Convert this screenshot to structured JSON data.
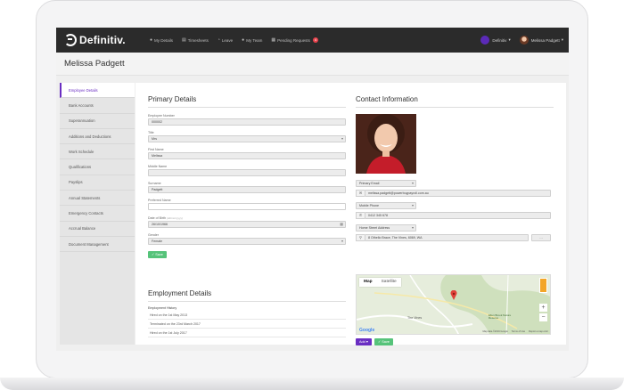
{
  "nav": {
    "brand": "Definitiv.",
    "items": [
      {
        "icon": "person-icon",
        "label": "My Details"
      },
      {
        "icon": "timesheet-icon",
        "label": "Timesheets"
      },
      {
        "icon": "leave-icon",
        "label": "Leave"
      },
      {
        "icon": "team-icon",
        "label": "My Team"
      },
      {
        "icon": "pending-icon",
        "label": "Pending Requests",
        "badge": "4"
      }
    ],
    "org": "Definitiv",
    "user": "Melissa Padgett"
  },
  "page": {
    "title": "Melissa Padgett"
  },
  "sidebar": {
    "items": [
      {
        "label": "Employee Details",
        "active": true
      },
      {
        "label": "Bank Accounts"
      },
      {
        "label": "Superannuation"
      },
      {
        "label": "Additions and Deductions"
      },
      {
        "label": "Work Schedule"
      },
      {
        "label": "Qualifications"
      },
      {
        "label": "Payslips"
      },
      {
        "label": "Annual Statements"
      },
      {
        "label": "Emergency Contacts"
      },
      {
        "label": "Accrual Balance"
      },
      {
        "label": "Document Management"
      }
    ]
  },
  "primary": {
    "title": "Primary Details",
    "employee_number_label": "Employee Number",
    "employee_number": "000002",
    "title_label": "Title",
    "title_value": "Mrs",
    "first_name_label": "First Name",
    "first_name": "Melissa",
    "middle_name_label": "Middle Name",
    "middle_name": "",
    "surname_label": "Surname",
    "surname": "Padgett",
    "preferred_name_label": "Preferred Name",
    "preferred_name": "",
    "dob_label": "Date of Birth",
    "dob_hint": "(dd/mm/yyyy)",
    "dob": "26/10/1966",
    "gender_label": "Gender",
    "gender": "Female",
    "save": "Save"
  },
  "employment": {
    "title": "Employment Details",
    "history_label": "Employment History",
    "rows": [
      "Hired on the 1st May 2013",
      "Terminated on the 23rd March 2017",
      "Hired on the 1st July 2017"
    ]
  },
  "contact": {
    "title": "Contact Information",
    "email_type": "Primary Email",
    "email": "melissa.padgett@powerbuypayroll.com.au",
    "phone_type": "Mobile Phone",
    "phone": "0412 345 678",
    "address_type": "Home Street Address",
    "address": "8 Othello Brace, The Vines, 6069, WA",
    "map_tab_map": "Map",
    "map_tab_satellite": "Satellite",
    "map_label_vines": "The Vines",
    "map_label_reserve": "Ellen Brook Nature Reserve",
    "map_data": "Map data ©2019 Google",
    "map_terms": "Terms of Use",
    "map_report": "Report a map error",
    "google": "Google",
    "add": "Add",
    "save": "Save"
  }
}
